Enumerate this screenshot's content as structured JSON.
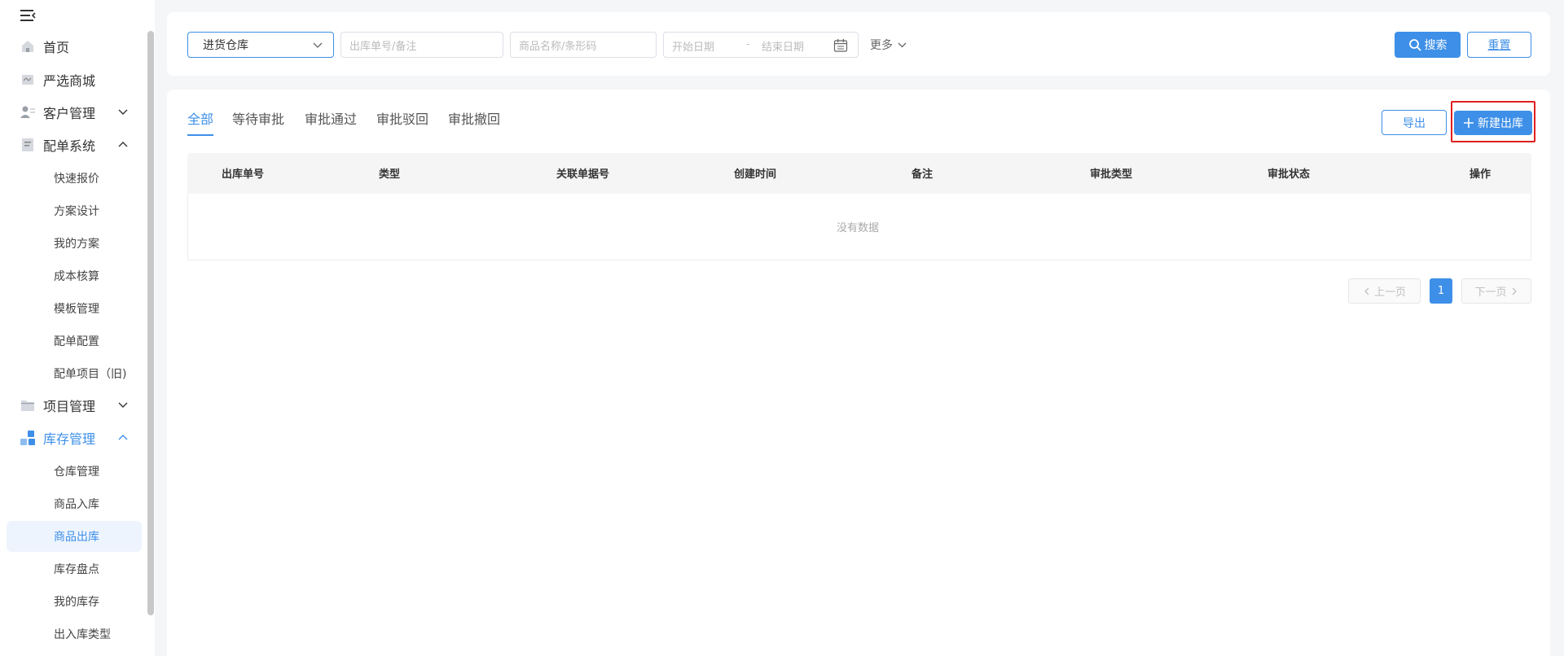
{
  "sidebar": {
    "items": [
      {
        "label": "首页",
        "icon": "home-icon"
      },
      {
        "label": "严选商城",
        "icon": "mall-icon"
      },
      {
        "label": "客户管理",
        "icon": "customer-icon"
      },
      {
        "label": "配单系统",
        "icon": "order-icon"
      },
      {
        "label": "项目管理",
        "icon": "folder-icon"
      },
      {
        "label": "库存管理",
        "icon": "inventory-icon"
      }
    ],
    "order_sub": [
      "快速报价",
      "方案设计",
      "我的方案",
      "成本核算",
      "模板管理",
      "配单配置",
      "配单项目（旧)"
    ],
    "inventory_sub": [
      "仓库管理",
      "商品入库",
      "商品出库",
      "库存盘点",
      "我的库存",
      "出入库类型"
    ]
  },
  "search": {
    "warehouse": "进货仓库",
    "order_placeholder": "出库单号/备注",
    "product_placeholder": "商品名称/条形码",
    "start_date": "开始日期",
    "date_sep": "-",
    "end_date": "结束日期",
    "more": "更多",
    "search_btn": "搜索",
    "reset_btn": "重置"
  },
  "tabs": [
    "全部",
    "等待审批",
    "审批通过",
    "审批驳回",
    "审批撤回"
  ],
  "actions": {
    "export": "导出",
    "new": "新建出库"
  },
  "table": {
    "columns": [
      "出库单号",
      "类型",
      "关联单据号",
      "创建时间",
      "备注",
      "审批类型",
      "审批状态",
      "操作"
    ],
    "empty": "没有数据"
  },
  "pagination": {
    "prev": "上一页",
    "page": "1",
    "next": "下一页"
  },
  "colors": {
    "accent": "#3d8fe8",
    "highlight": "#e02020"
  }
}
